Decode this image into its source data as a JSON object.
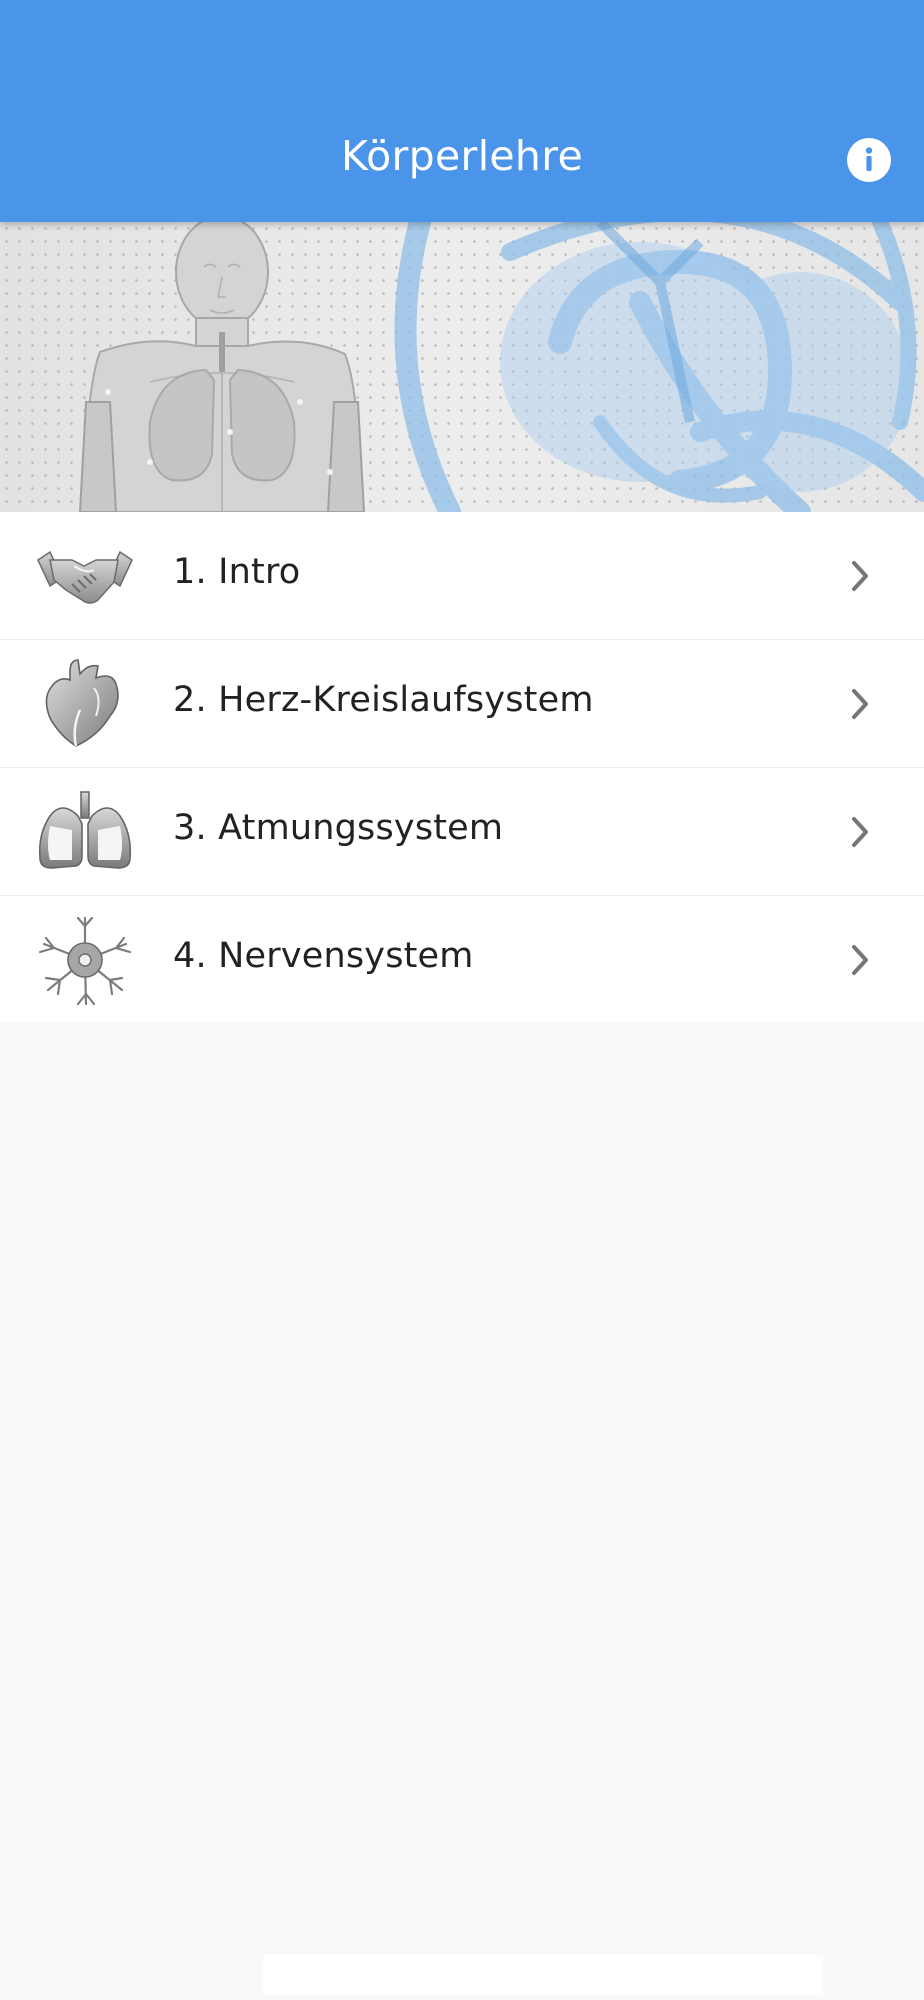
{
  "header": {
    "title": "Körperlehre",
    "info_icon": "info-circle-icon"
  },
  "banner": {
    "description_icon": "anatomy-illustration"
  },
  "menu": {
    "items": [
      {
        "label": "1. Intro",
        "icon": "handshake-icon"
      },
      {
        "label": "2. Herz-Kreislaufsystem",
        "icon": "heart-icon"
      },
      {
        "label": "3. Atmungssystem",
        "icon": "lungs-icon"
      },
      {
        "label": "4. Nervensystem",
        "icon": "neuron-icon"
      }
    ]
  },
  "colors": {
    "accent": "#4a94e9",
    "background": "#f9f9f9",
    "text": "#222222",
    "chevron": "#757575"
  }
}
